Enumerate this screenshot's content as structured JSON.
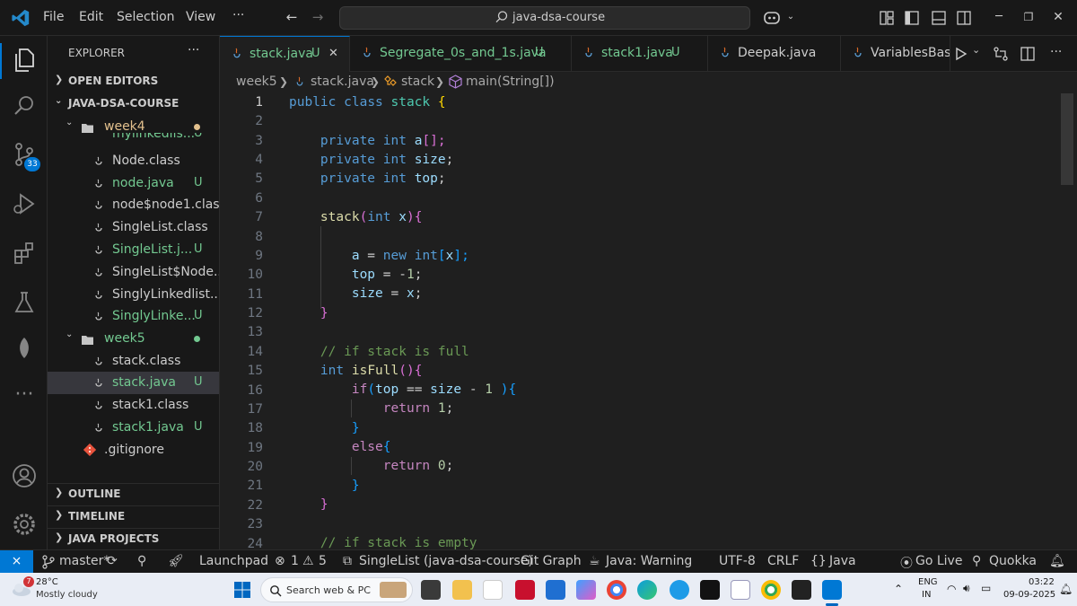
{
  "menu": {
    "file": "File",
    "edit": "Edit",
    "selection": "Selection",
    "view": "View",
    "more": "···"
  },
  "search": {
    "label": "java-dsa-course"
  },
  "activity": {
    "scm_badge": "33"
  },
  "sidebar": {
    "header": "EXPLORER",
    "open_editors": "OPEN EDITORS",
    "project": "JAVA-DSA-COURSE",
    "folder_week4": "week4",
    "folder_week5": "week5",
    "items": [
      {
        "label": "mylinkedlis...",
        "badge": "U"
      },
      {
        "label": "Node.class",
        "badge": ""
      },
      {
        "label": "node.java",
        "badge": "U"
      },
      {
        "label": "node$node1.class",
        "badge": ""
      },
      {
        "label": "SingleList.class",
        "badge": ""
      },
      {
        "label": "SingleList.j...",
        "badge": "U"
      },
      {
        "label": "SingleList$Node...",
        "badge": ""
      },
      {
        "label": "SinglyLinkedlist....",
        "badge": ""
      },
      {
        "label": "SinglyLinke...",
        "badge": "U"
      }
    ],
    "week5_items": [
      {
        "label": "stack.class",
        "badge": ""
      },
      {
        "label": "stack.java",
        "badge": "U"
      },
      {
        "label": "stack1.class",
        "badge": ""
      },
      {
        "label": "stack1.java",
        "badge": "U"
      }
    ],
    "gitignore": ".gitignore",
    "outline": "OUTLINE",
    "timeline": "TIMELINE",
    "java_projects": "JAVA PROJECTS"
  },
  "tabs": [
    {
      "label": "stack.java",
      "badge": "U",
      "close": "✕"
    },
    {
      "label": "Segregate_0s_and_1s.java",
      "badge": "U"
    },
    {
      "label": "stack1.java",
      "badge": "U"
    },
    {
      "label": "Deepak.java",
      "badge": ""
    },
    {
      "label": "VariablesBasi",
      "badge": ""
    }
  ],
  "breadcrumb": {
    "folder": "week5",
    "file": "stack.java",
    "class": "stack",
    "method": "main(String[])"
  },
  "code": {
    "line_numbers": [
      "1",
      "2",
      "3",
      "4",
      "5",
      "6",
      "7",
      "8",
      "9",
      "10",
      "11",
      "12",
      "13",
      "14",
      "15",
      "16",
      "17",
      "18",
      "19",
      "20",
      "21",
      "22",
      "23",
      "24"
    ],
    "l1": [
      "public",
      "class",
      "stack",
      "{"
    ],
    "l3": [
      "private",
      "int",
      "a",
      "[];"
    ],
    "l4": [
      "private",
      "int",
      "size",
      ";"
    ],
    "l5": [
      "private",
      "int",
      "top",
      ";"
    ],
    "l7": [
      "stack",
      "(",
      "int",
      "x",
      "){"
    ],
    "l9": [
      "a",
      " = ",
      "new",
      "int",
      "[",
      "x",
      "];"
    ],
    "l10": [
      "top",
      " = -",
      "1",
      ";"
    ],
    "l11": [
      "size",
      " = ",
      "x",
      ";"
    ],
    "l12": "}",
    "l14": "// if stack is full",
    "l15": [
      "int",
      "isFull",
      "(){"
    ],
    "l16": [
      "if",
      "(",
      "top",
      " == ",
      "size",
      " - ",
      "1",
      " ){"
    ],
    "l17": [
      "return",
      "1",
      ";"
    ],
    "l18": "}",
    "l19": [
      "else",
      "{"
    ],
    "l20": [
      "return",
      "0",
      ";"
    ],
    "l21": "}",
    "l22": "}",
    "l24": "// if stack is empty"
  },
  "status": {
    "branch": "master*",
    "launchpad": "Launchpad",
    "errors": "1",
    "warnings": "5",
    "project": "SingleList (java-dsa-course)",
    "git_graph": "Git Graph",
    "java_status": "Java: Warning",
    "encoding": "UTF-8",
    "eol": "CRLF",
    "language": "Java",
    "golive": "Go Live",
    "quokka": "Quokka"
  },
  "taskbar": {
    "weather_badge": "7",
    "temp": "28°C",
    "weather": "Mostly cloudy",
    "search": "Search web & PC",
    "lang1": "ENG",
    "lang2": "IN",
    "time": "03:22",
    "date": "09-09-2025"
  },
  "colors": {
    "accent": "#0078d4",
    "untracked": "#73c991",
    "modified": "#e2c08d"
  }
}
